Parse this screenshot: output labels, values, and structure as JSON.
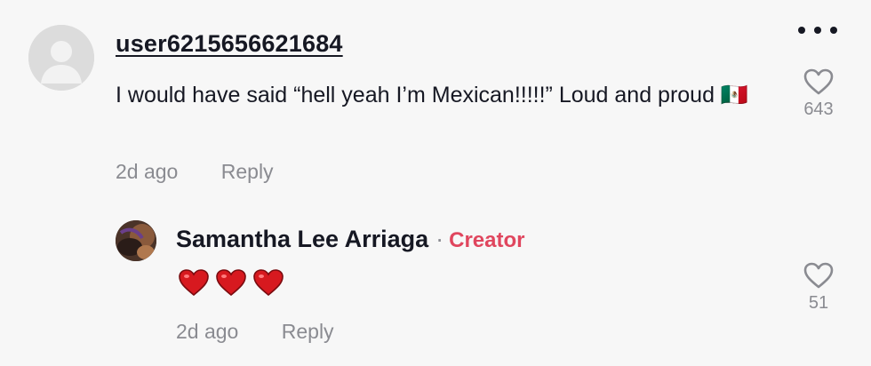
{
  "comment": {
    "username": "user6215656621684",
    "text": "I would have said “hell yeah I’m Mexican!!!!!” Loud and proud 🇲🇽",
    "time": "2d ago",
    "reply_label": "Reply",
    "like_count": "643",
    "avatar_icon": "default-avatar-icon",
    "more_icon": "more-options-icon"
  },
  "reply": {
    "author": "Samantha Lee Arriaga",
    "separator": "·",
    "badge": "Creator",
    "hearts": [
      "red-heart-emoji",
      "red-heart-emoji",
      "red-heart-emoji"
    ],
    "time": "2d ago",
    "reply_label": "Reply",
    "like_count": "51"
  },
  "colors": {
    "background": "#f7f7f7",
    "text": "#161823",
    "muted": "#8a8b91",
    "creator_badge": "#e0465e",
    "heart_emoji": "#d7191f"
  }
}
